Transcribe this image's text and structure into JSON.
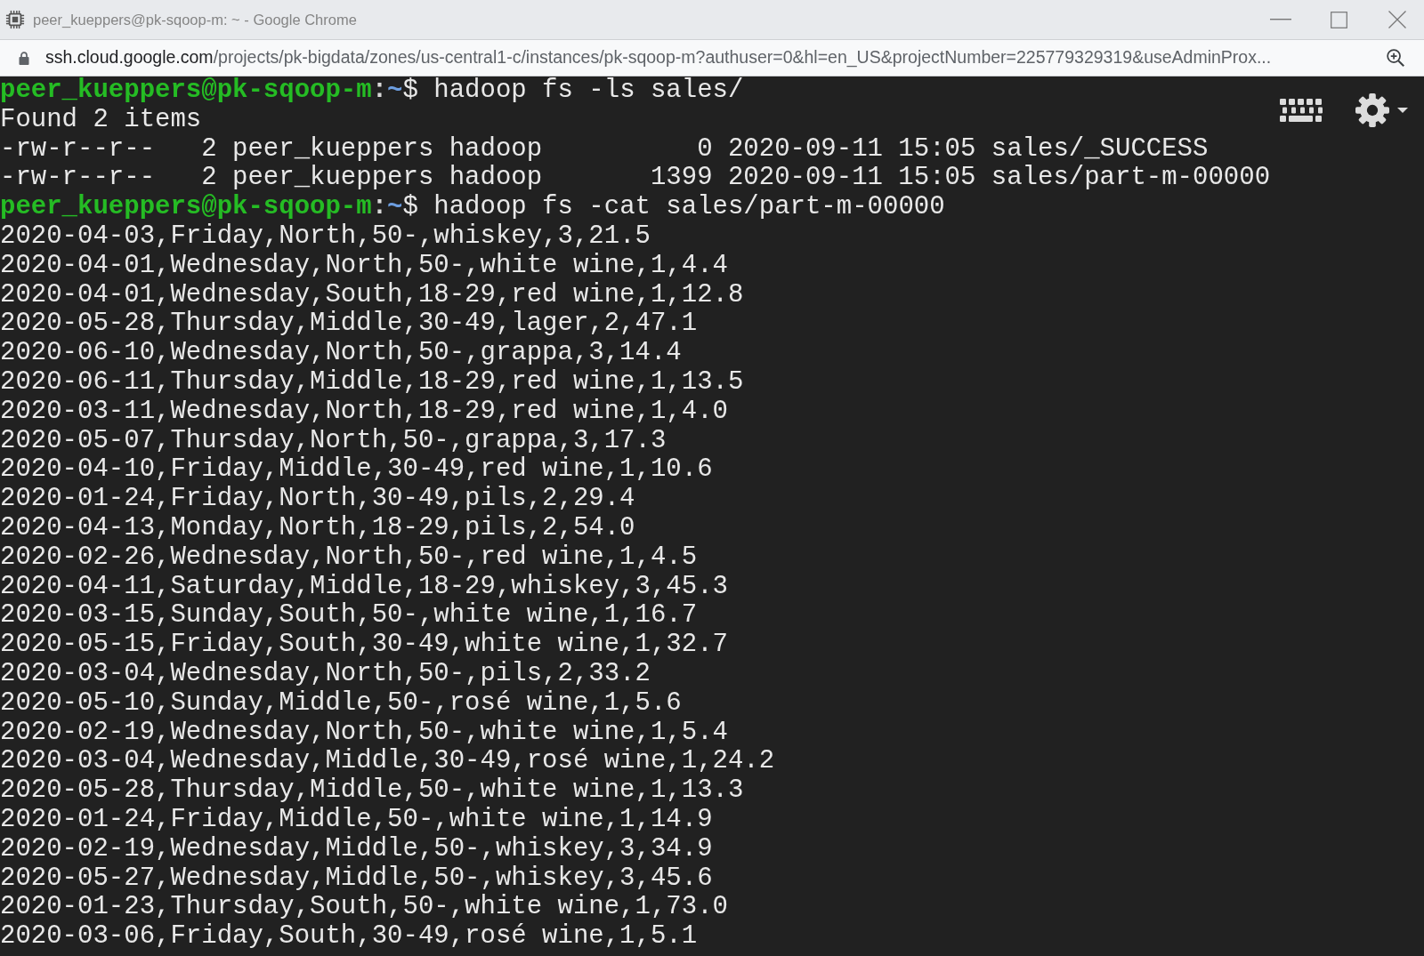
{
  "window": {
    "title": "peer_kueppers@pk-sqoop-m: ~ - Google Chrome"
  },
  "address_bar": {
    "host": "ssh.cloud.google.com",
    "path": "/projects/pk-bigdata/zones/us-central1-c/instances/pk-sqoop-m?authuser=0&hl=en_US&projectNumber=225779329319&useAdminProx..."
  },
  "terminal": {
    "lines": [
      {
        "kind": "prompt",
        "user_host": "peer_kueppers@pk-sqoop-m",
        "separator": ":",
        "cwd": "~",
        "symbol": "$",
        "command": "hadoop fs -ls sales/"
      },
      {
        "kind": "output",
        "text": "Found 2 items"
      },
      {
        "kind": "output",
        "text": "-rw-r--r--   2 peer_kueppers hadoop          0 2020-09-11 15:05 sales/_SUCCESS"
      },
      {
        "kind": "output",
        "text": "-rw-r--r--   2 peer_kueppers hadoop       1399 2020-09-11 15:05 sales/part-m-00000"
      },
      {
        "kind": "prompt",
        "user_host": "peer_kueppers@pk-sqoop-m",
        "separator": ":",
        "cwd": "~",
        "symbol": "$",
        "command": "hadoop fs -cat sales/part-m-00000"
      },
      {
        "kind": "output",
        "text": "2020-04-03,Friday,North,50-,whiskey,3,21.5"
      },
      {
        "kind": "output",
        "text": "2020-04-01,Wednesday,North,50-,white wine,1,4.4"
      },
      {
        "kind": "output",
        "text": "2020-04-01,Wednesday,South,18-29,red wine,1,12.8"
      },
      {
        "kind": "output",
        "text": "2020-05-28,Thursday,Middle,30-49,lager,2,47.1"
      },
      {
        "kind": "output",
        "text": "2020-06-10,Wednesday,North,50-,grappa,3,14.4"
      },
      {
        "kind": "output",
        "text": "2020-06-11,Thursday,Middle,18-29,red wine,1,13.5"
      },
      {
        "kind": "output",
        "text": "2020-03-11,Wednesday,North,18-29,red wine,1,4.0"
      },
      {
        "kind": "output",
        "text": "2020-05-07,Thursday,North,50-,grappa,3,17.3"
      },
      {
        "kind": "output",
        "text": "2020-04-10,Friday,Middle,30-49,red wine,1,10.6"
      },
      {
        "kind": "output",
        "text": "2020-01-24,Friday,North,30-49,pils,2,29.4"
      },
      {
        "kind": "output",
        "text": "2020-04-13,Monday,North,18-29,pils,2,54.0"
      },
      {
        "kind": "output",
        "text": "2020-02-26,Wednesday,North,50-,red wine,1,4.5"
      },
      {
        "kind": "output",
        "text": "2020-04-11,Saturday,Middle,18-29,whiskey,3,45.3"
      },
      {
        "kind": "output",
        "text": "2020-03-15,Sunday,South,50-,white wine,1,16.7"
      },
      {
        "kind": "output",
        "text": "2020-05-15,Friday,South,30-49,white wine,1,32.7"
      },
      {
        "kind": "output",
        "text": "2020-03-04,Wednesday,North,50-,pils,2,33.2"
      },
      {
        "kind": "output",
        "text": "2020-05-10,Sunday,Middle,50-,rosé wine,1,5.6"
      },
      {
        "kind": "output",
        "text": "2020-02-19,Wednesday,North,50-,white wine,1,5.4"
      },
      {
        "kind": "output",
        "text": "2020-03-04,Wednesday,Middle,30-49,rosé wine,1,24.2"
      },
      {
        "kind": "output",
        "text": "2020-05-28,Thursday,Middle,50-,white wine,1,13.3"
      },
      {
        "kind": "output",
        "text": "2020-01-24,Friday,Middle,50-,white wine,1,14.9"
      },
      {
        "kind": "output",
        "text": "2020-02-19,Wednesday,Middle,50-,whiskey,3,34.9"
      },
      {
        "kind": "output",
        "text": "2020-05-27,Wednesday,Middle,50-,whiskey,3,45.6"
      },
      {
        "kind": "output",
        "text": "2020-01-23,Thursday,South,50-,white wine,1,73.0"
      },
      {
        "kind": "output",
        "text": "2020-03-06,Friday,South,30-49,rosé wine,1,5.1"
      }
    ]
  }
}
